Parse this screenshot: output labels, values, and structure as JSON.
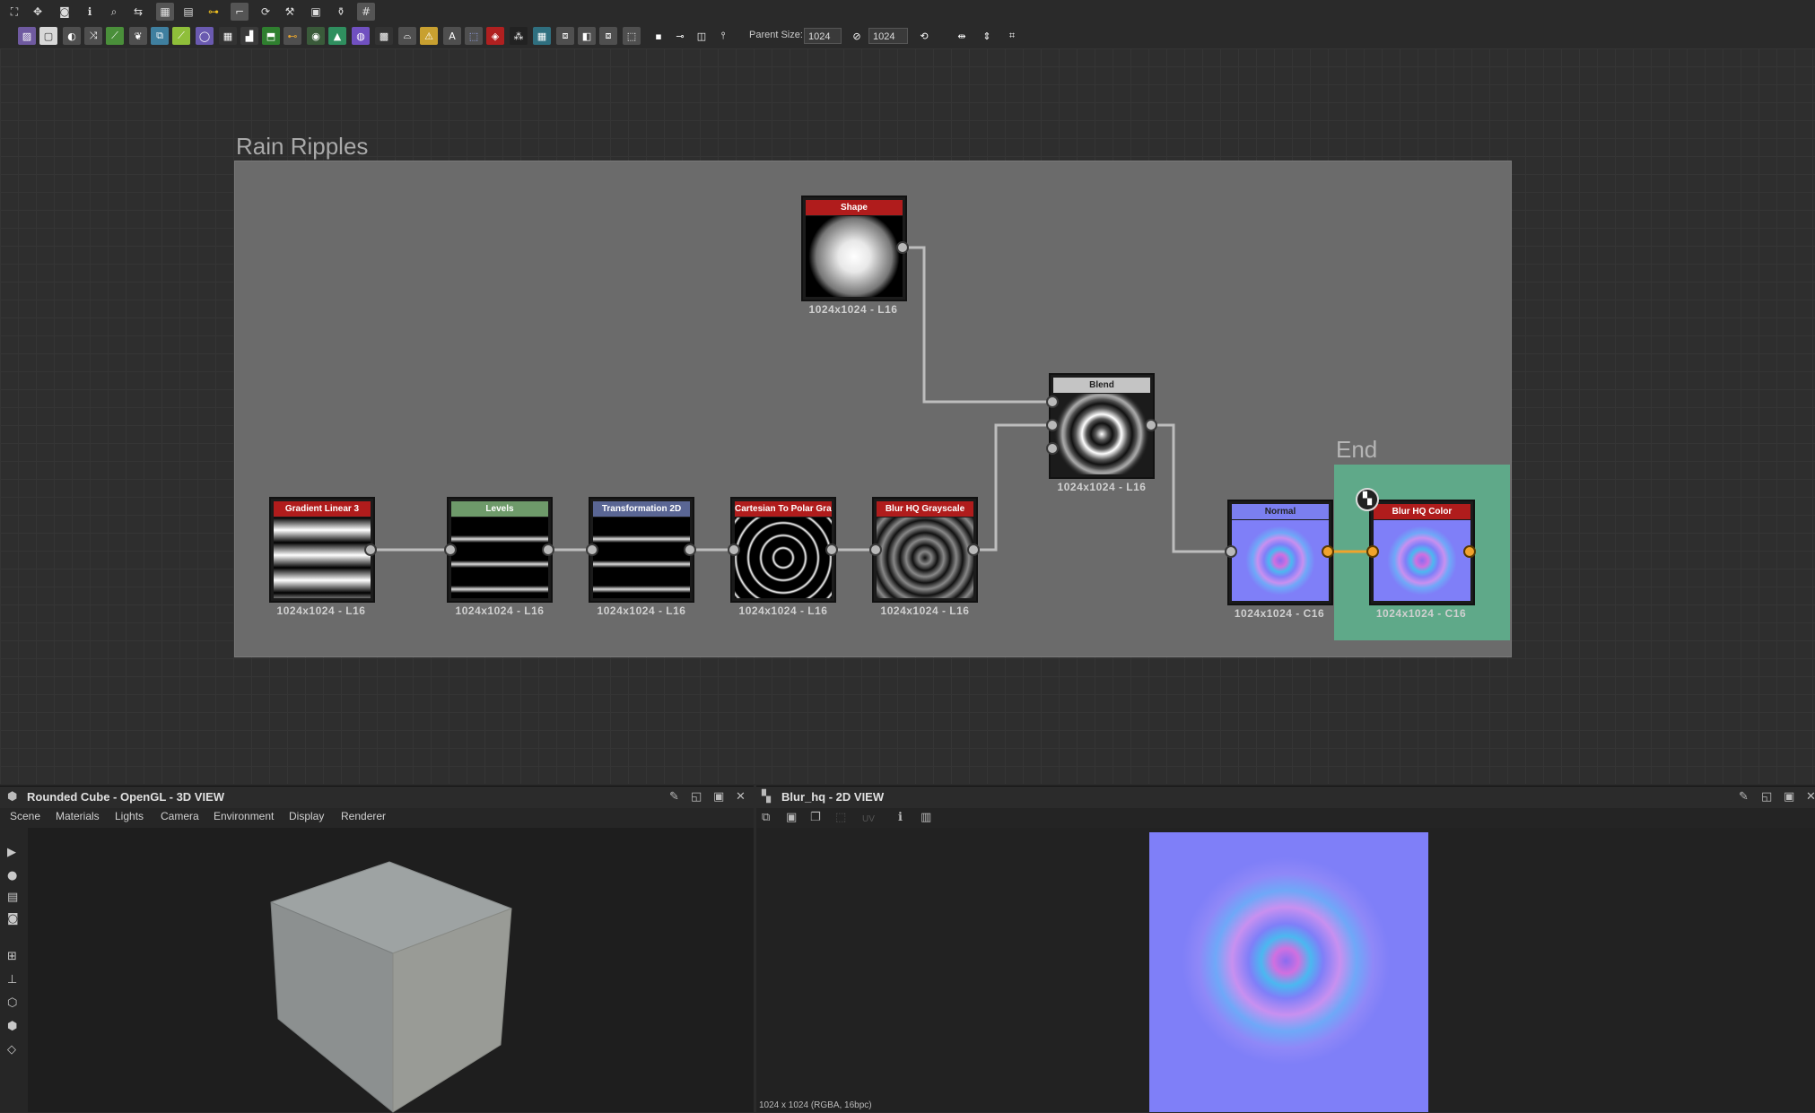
{
  "toolbar": {
    "parent_size_label": "Parent Size:",
    "parent_size_value": "1024",
    "size_value_2": "1024"
  },
  "graph": {
    "frame_title": "Rain Ripples",
    "end_frame_title": "End",
    "nodes": {
      "shape": {
        "title": "Shape",
        "res": "1024x1024 - L16",
        "color": "#b01c1c"
      },
      "blend": {
        "title": "Blend",
        "res": "1024x1024 - L16",
        "color": "#c4c4c4"
      },
      "gradient": {
        "title": "Gradient Linear 3",
        "res": "1024x1024 - L16",
        "color": "#b01c1c"
      },
      "levels": {
        "title": "Levels",
        "res": "1024x1024 - L16",
        "color": "#6e9a6a"
      },
      "transform": {
        "title": "Transformation 2D",
        "res": "1024x1024 - L16",
        "color": "#5a6694"
      },
      "polar": {
        "title": "Cartesian To Polar Gra...",
        "res": "1024x1024 - L16",
        "color": "#b01c1c"
      },
      "blurgray": {
        "title": "Blur HQ Grayscale",
        "res": "1024x1024 - L16",
        "color": "#b01c1c"
      },
      "normal": {
        "title": "Normal",
        "res": "1024x1024 - C16",
        "color": "#7b7ff0"
      },
      "blurcolor": {
        "title": "Blur HQ Color",
        "res": "1024x1024 - C16",
        "color": "#b01c1c"
      }
    }
  },
  "view3d": {
    "title": "Rounded Cube - OpenGL - 3D VIEW",
    "menu": [
      "Scene",
      "Materials",
      "Lights",
      "Camera",
      "Environment",
      "Display",
      "Renderer"
    ]
  },
  "view2d": {
    "title": "Blur_hq - 2D VIEW",
    "uv_label": "UV",
    "status": "1024 x 1024 (RGBA, 16bpc)"
  }
}
